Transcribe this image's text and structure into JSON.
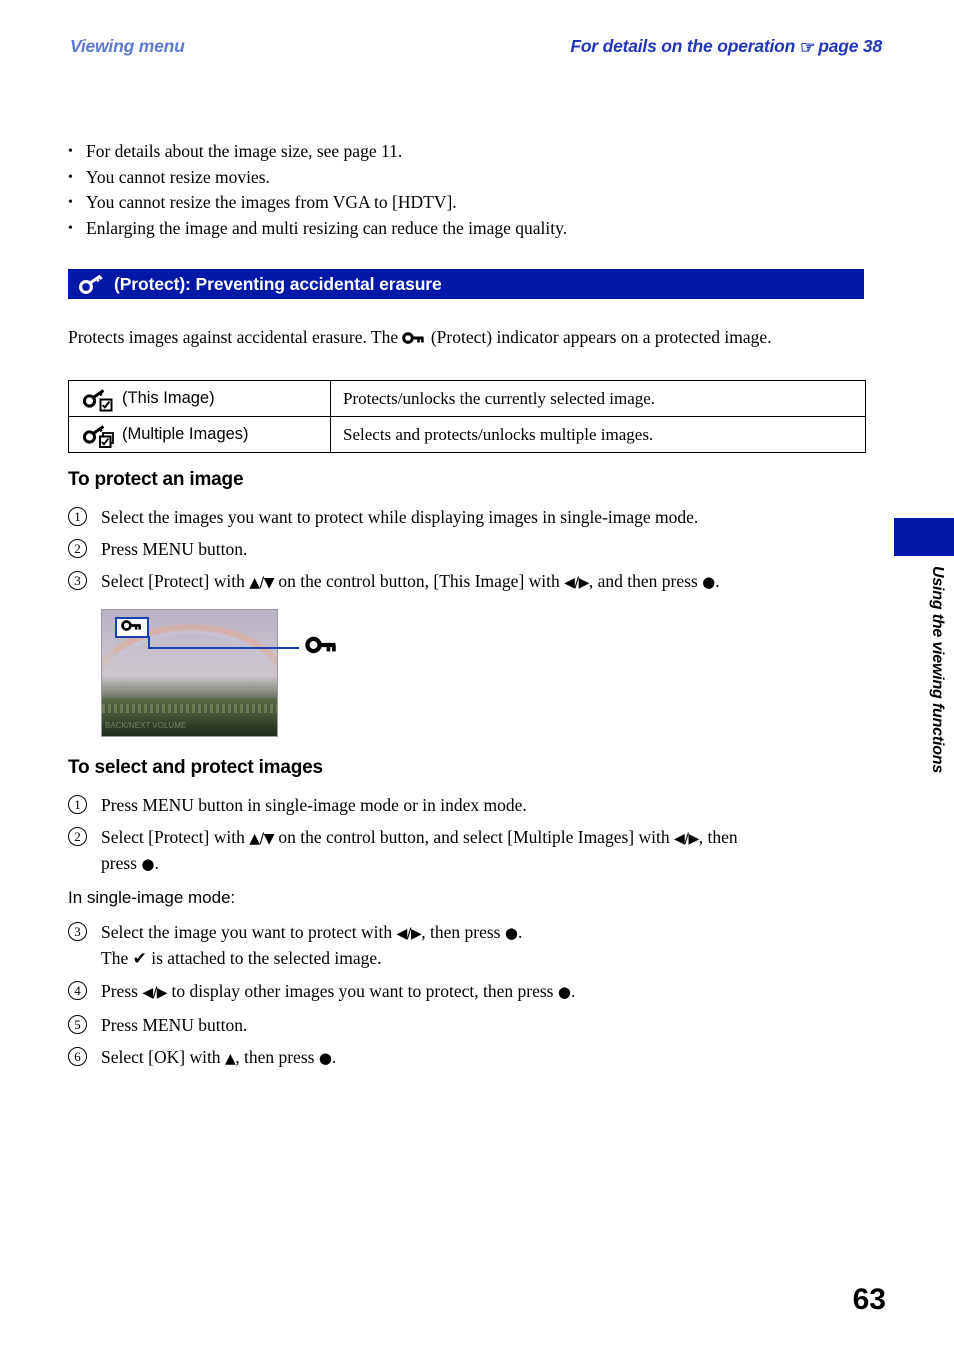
{
  "header": {
    "left_title": "Viewing menu",
    "right_text_before": "For details on the operation",
    "hand_icon": "pointing-hand-icon",
    "right_page_ref": "page 38"
  },
  "bullets": [
    "For details about the image size, see page 11.",
    "You cannot resize movies.",
    "You cannot resize the images from VGA to [HDTV].",
    "Enlarging the image and multi resizing can reduce the image quality."
  ],
  "section": {
    "icon": "key-protect-icon",
    "title": "(Protect): Preventing accidental erasure",
    "bar_color": "#0018a8"
  },
  "intro": {
    "part1": "Protects images against accidental erasure. The",
    "icon": "key-protect-indicator-icon",
    "part2": "(Protect) indicator appears on a protected image."
  },
  "table": {
    "rows": [
      {
        "icon": "key-this-image-icon",
        "label": "(This Image)",
        "description": "Protects/unlocks the currently selected image."
      },
      {
        "icon": "key-multiple-images-icon",
        "label": "(Multiple Images)",
        "description": "Selects and protects/unlocks multiple images."
      }
    ]
  },
  "section_protect_image": {
    "heading": "To protect an image",
    "steps": [
      {
        "num": "1",
        "text": "Select the images you want to protect while displaying images in single-image mode."
      },
      {
        "num": "2",
        "text": "Press MENU button."
      },
      {
        "num": "3",
        "text_a": "Select [Protect] with",
        "ctl_a": "▲/▼",
        "text_b": "on the control button, [This Image] with",
        "ctl_b": "◀/▶",
        "text_c": ", and then press",
        "dot": "●",
        "text_d": "."
      }
    ]
  },
  "illustration": {
    "photo_alt": "rainbow-landscape-photo",
    "osd_key_icon": "key-protect-indicator-icon",
    "osd_text": "BACK/NEXT        VOLUME",
    "callout_icon": "key-protect-indicator-icon"
  },
  "section_select_protect": {
    "heading": "To select and protect images",
    "steps": [
      {
        "num": "1",
        "text": "Press MENU button in single-image mode or in index mode."
      },
      {
        "num": "2",
        "text_a": "Select [Protect] with",
        "ctl_a": "▲/▼",
        "text_b": "on the control button, and select [Multiple Images] with",
        "ctl_b": "◀/▶",
        "text_c": ", then",
        "line2_a": "press",
        "dot": "●",
        "line2_b": "."
      }
    ],
    "mode_label": "In single-image mode:",
    "steps2": [
      {
        "num": "3",
        "text_a": "Select the image you want to protect with",
        "ctl_a": "◀/▶",
        "text_b": ", then press",
        "dot": "●",
        "text_c": ".",
        "line2_a": "The",
        "tick": "✔",
        "line2_b": "is attached to the selected image."
      },
      {
        "num": "4",
        "text_a": "Press",
        "ctl_a": "◀/▶",
        "text_b": "to display other images you want to protect, then press",
        "dot": "●",
        "text_c": "."
      },
      {
        "num": "5",
        "text": "Press MENU button."
      },
      {
        "num": "6",
        "text_a": "Select [OK] with",
        "ctl_a": "▲",
        "text_b": ", then press",
        "dot": "●",
        "text_c": "."
      }
    ]
  },
  "side_tab": {
    "label": "Using the viewing functions",
    "color": "#0018a8"
  },
  "page_number": "63"
}
